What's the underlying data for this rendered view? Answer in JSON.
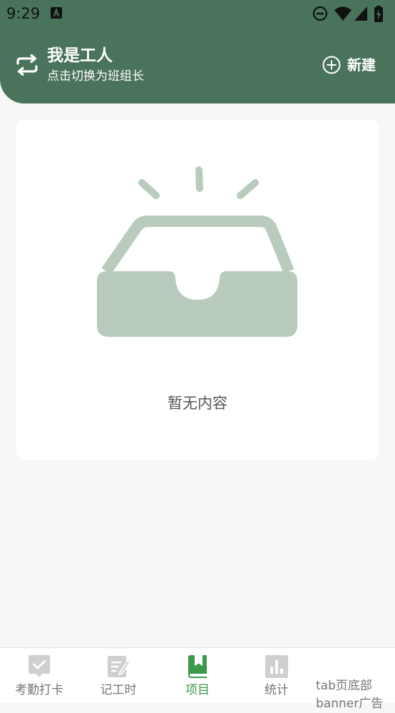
{
  "status_bar": {
    "time": "9:29",
    "icons": [
      "app-a-icon",
      "do-not-disturb-icon",
      "wifi-icon",
      "cellular-signal-icon",
      "battery-charging-icon"
    ]
  },
  "header": {
    "role_switch_icon": "swap-arrows-icon",
    "role_title": "我是工人",
    "role_subtitle": "点击切换为班组长",
    "new_button": {
      "icon": "plus-circle-icon",
      "label": "新建"
    },
    "background_color": "#4a735b"
  },
  "empty_state": {
    "illustration": "empty-inbox-tray-icon",
    "illustration_color": "#b8cbbd",
    "message": "暂无内容"
  },
  "tabbar": {
    "items": [
      {
        "label": "考勤打卡",
        "icon": "clock-in-check-icon",
        "active": false
      },
      {
        "label": "记工时",
        "icon": "edit-note-icon",
        "active": false
      },
      {
        "label": "项目",
        "icon": "bookmark-book-icon",
        "active": true
      },
      {
        "label": "统计",
        "icon": "bar-chart-icon",
        "active": false
      }
    ],
    "ad_text": "tab页底部banner广告",
    "active_color": "#3a9a4c",
    "inactive_color": "#cfcfcf"
  }
}
